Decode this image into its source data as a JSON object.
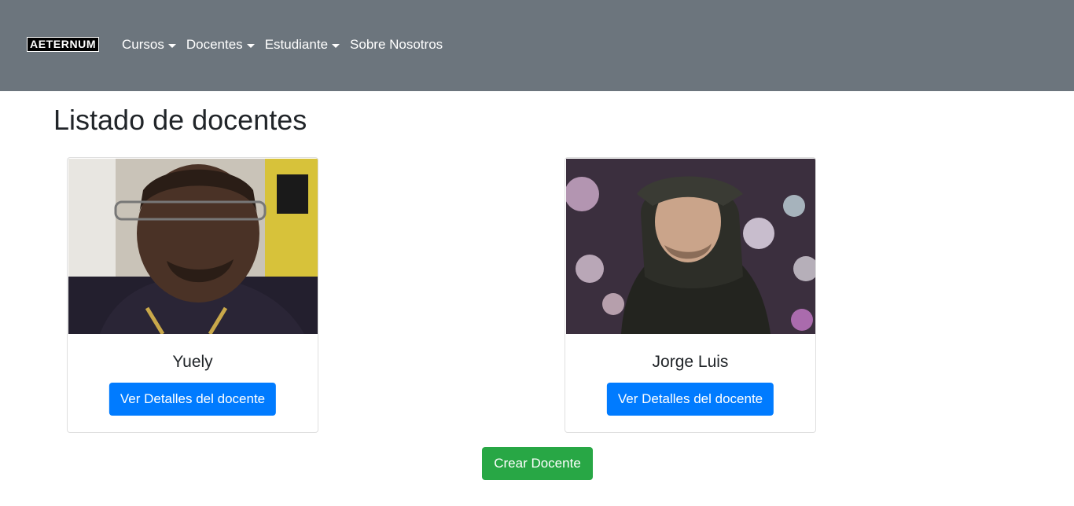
{
  "navbar": {
    "brand": "AETERNUM",
    "items": [
      {
        "label": "Cursos",
        "dropdown": true
      },
      {
        "label": "Docentes",
        "dropdown": true
      },
      {
        "label": "Estudiante",
        "dropdown": true
      },
      {
        "label": "Sobre Nosotros",
        "dropdown": false
      }
    ]
  },
  "page": {
    "title": "Listado de docentes"
  },
  "teachers": [
    {
      "name": "Yuely",
      "button_label": "Ver Detalles del docente"
    },
    {
      "name": "Jorge Luis",
      "button_label": "Ver Detalles del docente"
    }
  ],
  "actions": {
    "create_label": "Crear Docente"
  },
  "colors": {
    "navbar": "#6c757d",
    "primary": "#007bff",
    "success": "#28a745"
  }
}
